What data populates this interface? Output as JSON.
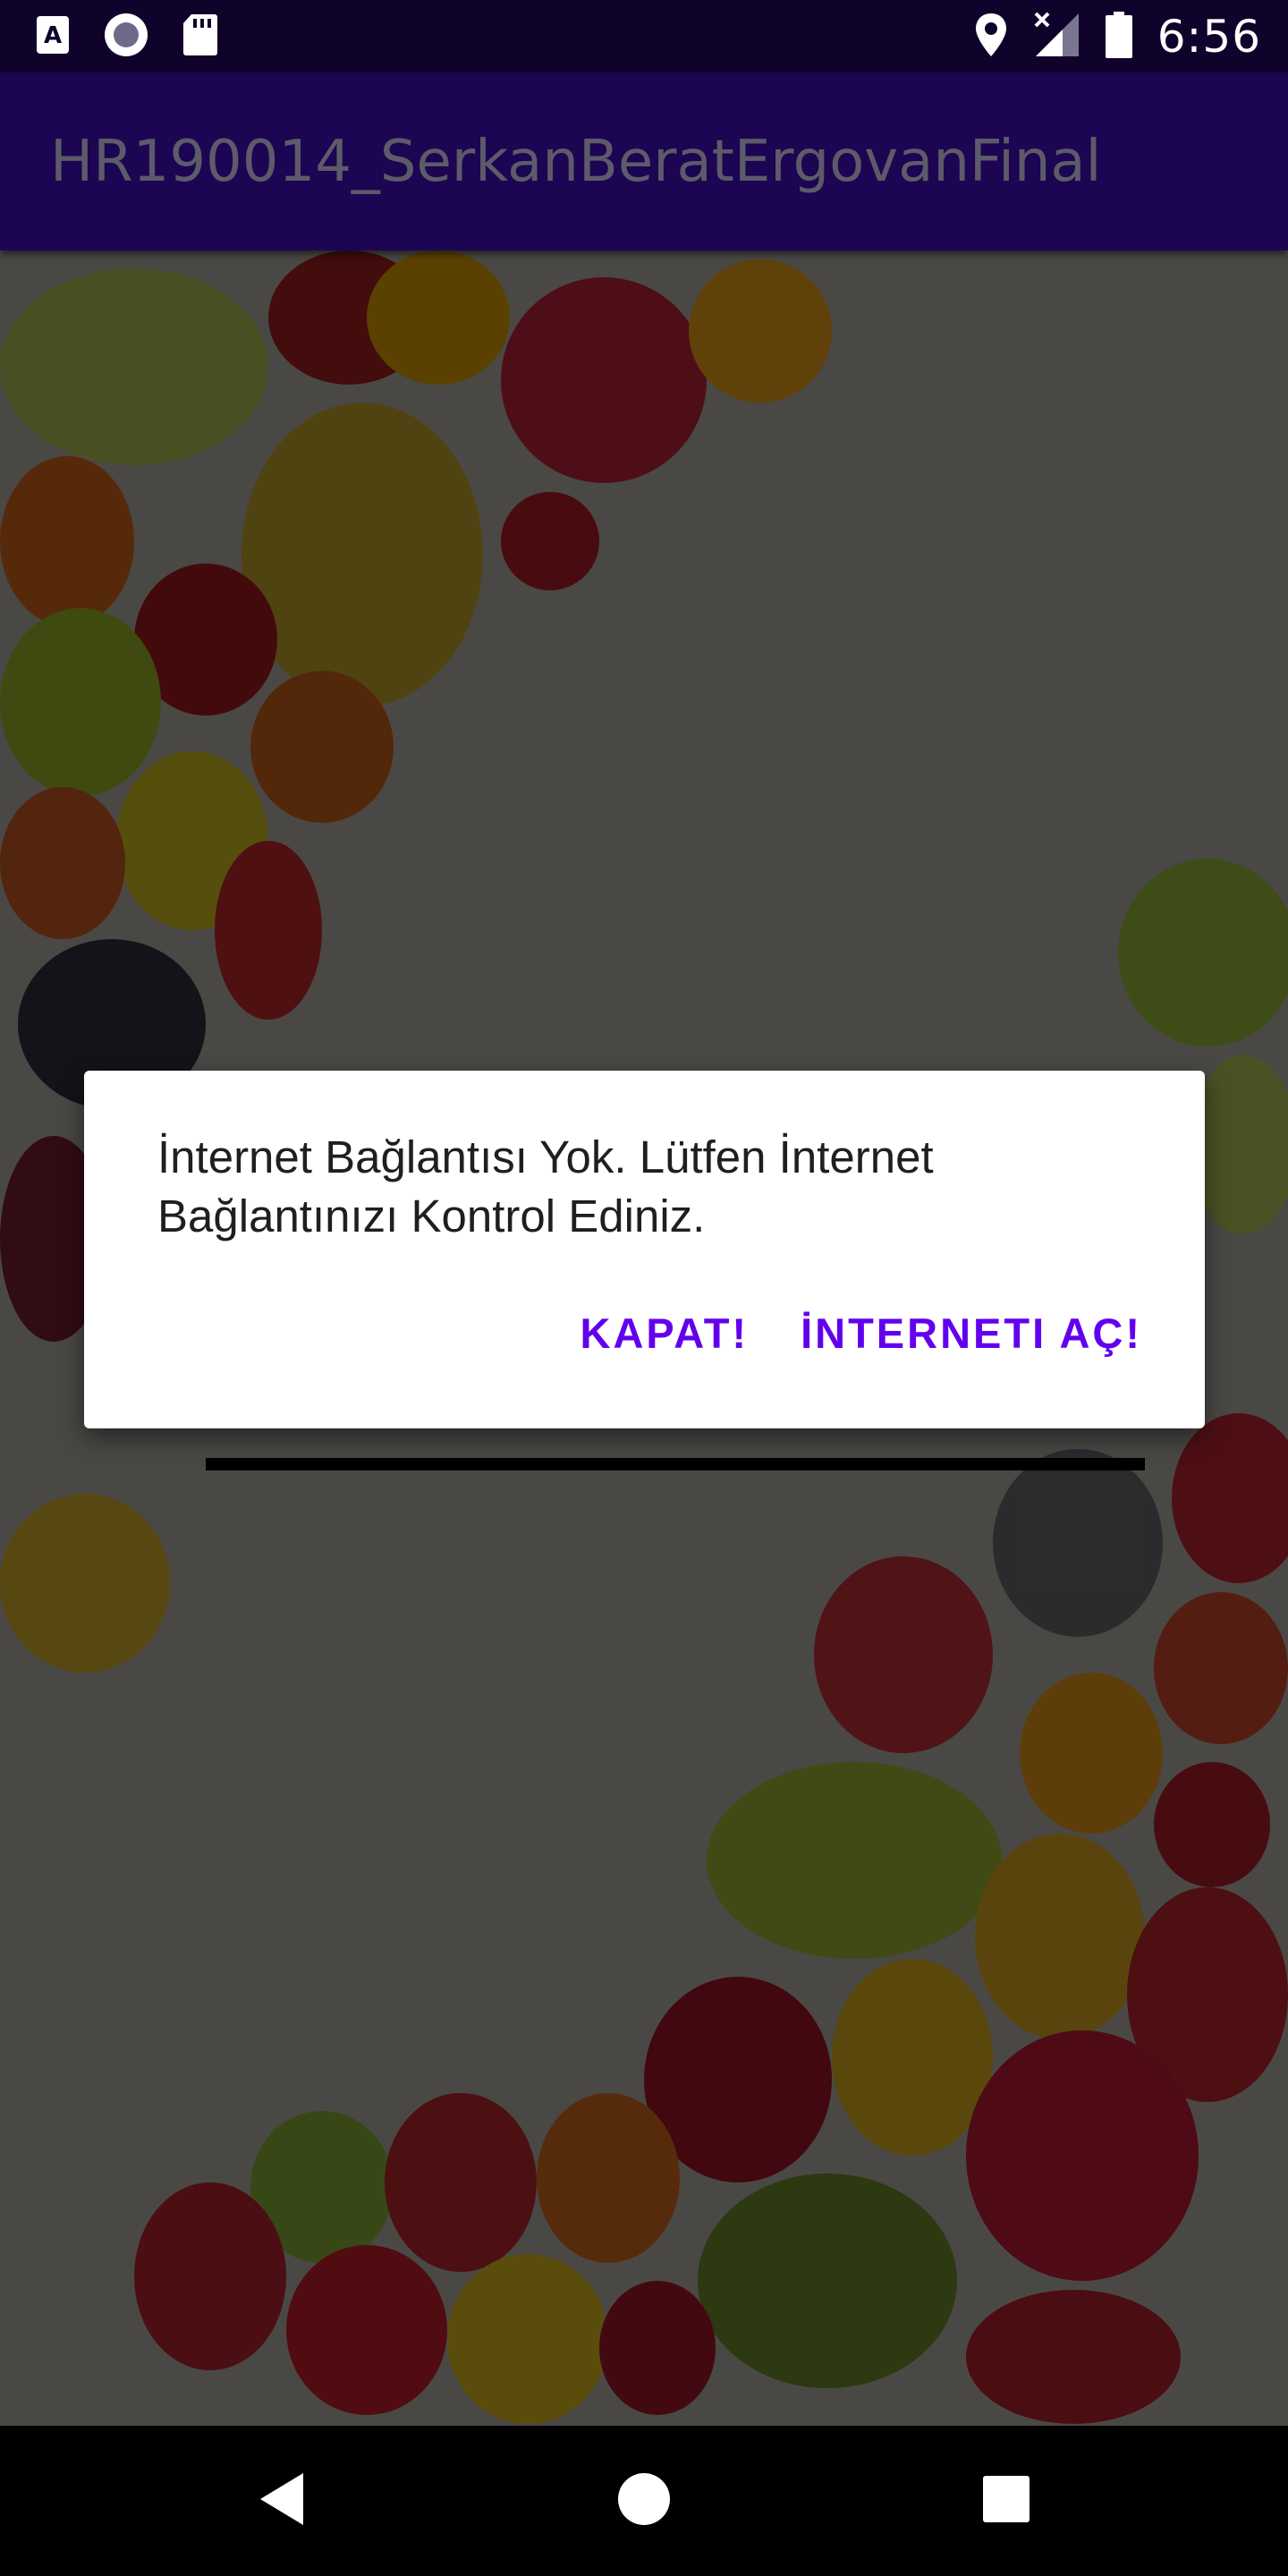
{
  "status_bar": {
    "time": "6:56",
    "left_icons": [
      "accessibility-a-icon",
      "record-icon",
      "sd-card-icon"
    ],
    "right_icons": [
      "location-icon",
      "signal-no-data-icon",
      "battery-icon"
    ]
  },
  "app_bar": {
    "title": "HR190014_SerkanBeratErgovanFinal"
  },
  "dialog": {
    "message": "İnternet Bağlantısı Yok. Lütfen İnternet Bağlantınızı Kontrol Ediniz.",
    "close_label": "KAPAT!",
    "open_internet_label": "İNTERNETI AÇ!"
  },
  "nav_bar": {
    "icons": [
      "back-icon",
      "home-icon",
      "recents-icon"
    ]
  },
  "colors": {
    "status_bar": "#10032b",
    "app_bar": "#1c0552",
    "dialog_button": "#6200ee"
  }
}
